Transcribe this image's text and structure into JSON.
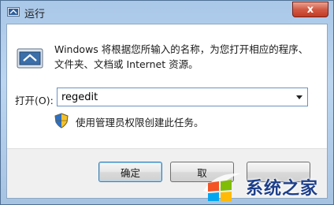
{
  "window": {
    "title": "运行",
    "close_glyph": "x"
  },
  "dialog": {
    "description": "Windows 将根据您所输入的名称，为您打开相应的程序、文件夹、文档或 Internet 资源。",
    "open_label": "打开(O):",
    "open_value": "regedit",
    "admin_note": "使用管理员权限创建此任务。"
  },
  "buttons": {
    "ok": "确定",
    "cancel": "取",
    "browse": ""
  },
  "watermark": {
    "text": "系统之家"
  },
  "icons": {
    "title": "run-icon",
    "main": "run-icon",
    "shield": "shield-icon",
    "dropdown": "chevron-down-icon",
    "watermark": "windows-logo-icon"
  },
  "colors": {
    "accent_border": "#6a91c2",
    "close_red": "#c23b25",
    "watermark_blue": "#1d3f8a"
  }
}
